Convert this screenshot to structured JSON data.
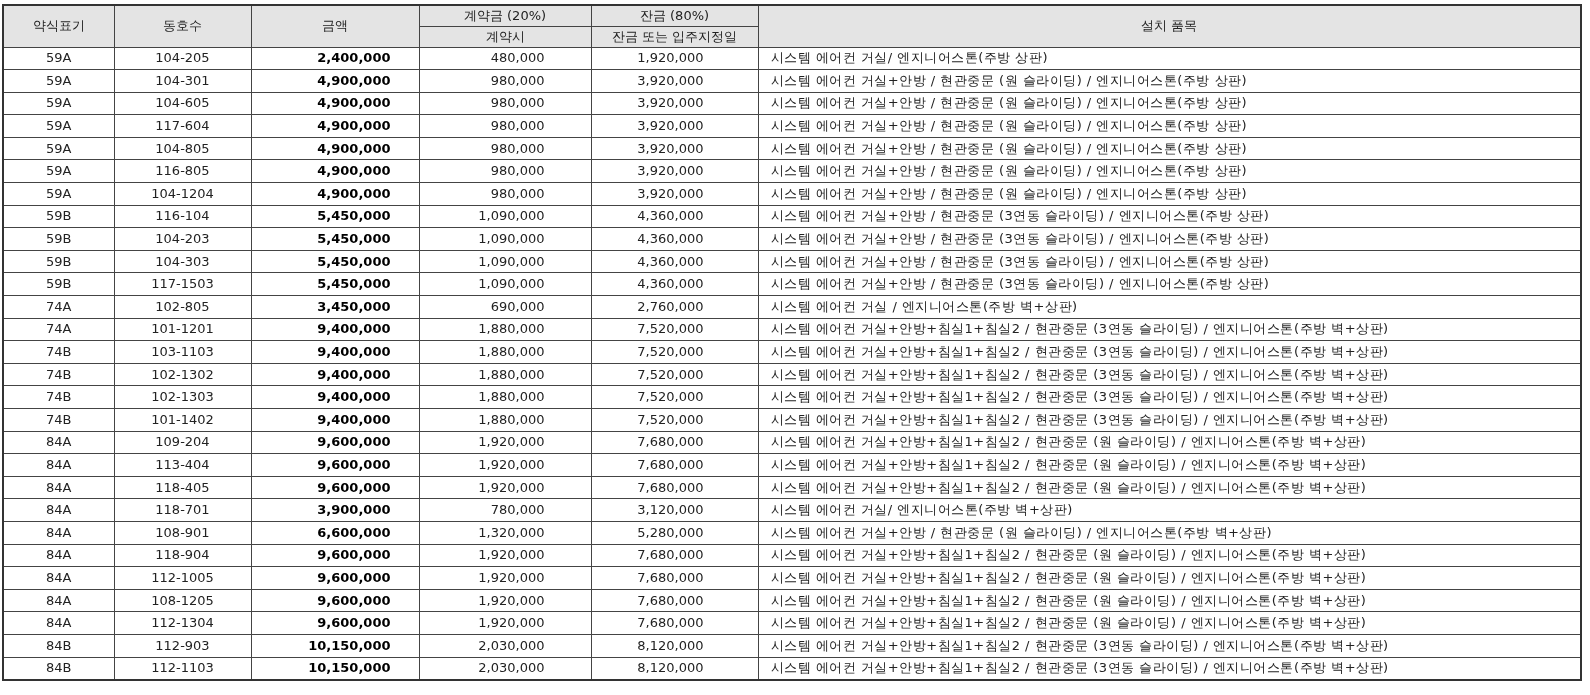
{
  "table": {
    "header": {
      "type": "약식표기",
      "unit": "동호수",
      "amount": "금액",
      "deposit_group": "계약금 (20%)",
      "deposit": "계약시",
      "balance_group": "잔금 (80%)",
      "balance": "잔금 또는 입주지정일",
      "items": "설치 품목"
    },
    "rows": [
      {
        "type": "59A",
        "unit": "104-205",
        "amount": "2,400,000",
        "deposit": "480,000",
        "balance": "1,920,000",
        "items": "시스템 에어컨 거실/ 엔지니어스톤(주방 상판)"
      },
      {
        "type": "59A",
        "unit": "104-301",
        "amount": "4,900,000",
        "deposit": "980,000",
        "balance": "3,920,000",
        "items": "시스템 에어컨 거실+안방 / 현관중문 (원 슬라이딩) / 엔지니어스톤(주방 상판)"
      },
      {
        "type": "59A",
        "unit": "104-605",
        "amount": "4,900,000",
        "deposit": "980,000",
        "balance": "3,920,000",
        "items": "시스템 에어컨 거실+안방 / 현관중문 (원 슬라이딩) / 엔지니어스톤(주방 상판)"
      },
      {
        "type": "59A",
        "unit": "117-604",
        "amount": "4,900,000",
        "deposit": "980,000",
        "balance": "3,920,000",
        "items": "시스템 에어컨 거실+안방 / 현관중문 (원 슬라이딩) / 엔지니어스톤(주방 상판)"
      },
      {
        "type": "59A",
        "unit": "104-805",
        "amount": "4,900,000",
        "deposit": "980,000",
        "balance": "3,920,000",
        "items": "시스템 에어컨 거실+안방 / 현관중문 (원 슬라이딩) / 엔지니어스톤(주방 상판)"
      },
      {
        "type": "59A",
        "unit": "116-805",
        "amount": "4,900,000",
        "deposit": "980,000",
        "balance": "3,920,000",
        "items": "시스템 에어컨 거실+안방 / 현관중문 (원 슬라이딩) / 엔지니어스톤(주방 상판)"
      },
      {
        "type": "59A",
        "unit": "104-1204",
        "amount": "4,900,000",
        "deposit": "980,000",
        "balance": "3,920,000",
        "items": "시스템 에어컨 거실+안방 / 현관중문 (원 슬라이딩) / 엔지니어스톤(주방 상판)"
      },
      {
        "type": "59B",
        "unit": "116-104",
        "amount": "5,450,000",
        "deposit": "1,090,000",
        "balance": "4,360,000",
        "items": "시스템 에어컨 거실+안방 / 현관중문 (3연동 슬라이딩) / 엔지니어스톤(주방 상판)"
      },
      {
        "type": "59B",
        "unit": "104-203",
        "amount": "5,450,000",
        "deposit": "1,090,000",
        "balance": "4,360,000",
        "items": "시스템 에어컨 거실+안방 / 현관중문 (3연동 슬라이딩) / 엔지니어스톤(주방 상판)"
      },
      {
        "type": "59B",
        "unit": "104-303",
        "amount": "5,450,000",
        "deposit": "1,090,000",
        "balance": "4,360,000",
        "items": "시스템 에어컨 거실+안방 / 현관중문 (3연동 슬라이딩) / 엔지니어스톤(주방 상판)"
      },
      {
        "type": "59B",
        "unit": "117-1503",
        "amount": "5,450,000",
        "deposit": "1,090,000",
        "balance": "4,360,000",
        "items": "시스템 에어컨 거실+안방 / 현관중문 (3연동 슬라이딩) / 엔지니어스톤(주방 상판)"
      },
      {
        "type": "74A",
        "unit": "102-805",
        "amount": "3,450,000",
        "deposit": "690,000",
        "balance": "2,760,000",
        "items": "시스템 에어컨 거실 / 엔지니어스톤(주방 벽+상판)"
      },
      {
        "type": "74A",
        "unit": "101-1201",
        "amount": "9,400,000",
        "deposit": "1,880,000",
        "balance": "7,520,000",
        "items": "시스템 에어컨 거실+안방+침실1+침실2 / 현관중문 (3연동 슬라이딩) / 엔지니어스톤(주방 벽+상판)"
      },
      {
        "type": "74B",
        "unit": "103-1103",
        "amount": "9,400,000",
        "deposit": "1,880,000",
        "balance": "7,520,000",
        "items": "시스템 에어컨 거실+안방+침실1+침실2 / 현관중문 (3연동 슬라이딩) / 엔지니어스톤(주방 벽+상판)"
      },
      {
        "type": "74B",
        "unit": "102-1302",
        "amount": "9,400,000",
        "deposit": "1,880,000",
        "balance": "7,520,000",
        "items": "시스템 에어컨 거실+안방+침실1+침실2 / 현관중문 (3연동 슬라이딩) / 엔지니어스톤(주방 벽+상판)"
      },
      {
        "type": "74B",
        "unit": "102-1303",
        "amount": "9,400,000",
        "deposit": "1,880,000",
        "balance": "7,520,000",
        "items": "시스템 에어컨 거실+안방+침실1+침실2 / 현관중문 (3연동 슬라이딩) / 엔지니어스톤(주방 벽+상판)"
      },
      {
        "type": "74B",
        "unit": "101-1402",
        "amount": "9,400,000",
        "deposit": "1,880,000",
        "balance": "7,520,000",
        "items": "시스템 에어컨 거실+안방+침실1+침실2 / 현관중문 (3연동 슬라이딩) / 엔지니어스톤(주방 벽+상판)"
      },
      {
        "type": "84A",
        "unit": "109-204",
        "amount": "9,600,000",
        "deposit": "1,920,000",
        "balance": "7,680,000",
        "items": "시스템 에어컨 거실+안방+침실1+침실2 / 현관중문 (원 슬라이딩) / 엔지니어스톤(주방 벽+상판)"
      },
      {
        "type": "84A",
        "unit": "113-404",
        "amount": "9,600,000",
        "deposit": "1,920,000",
        "balance": "7,680,000",
        "items": "시스템 에어컨 거실+안방+침실1+침실2 / 현관중문 (원 슬라이딩) / 엔지니어스톤(주방 벽+상판)"
      },
      {
        "type": "84A",
        "unit": "118-405",
        "amount": "9,600,000",
        "deposit": "1,920,000",
        "balance": "7,680,000",
        "items": "시스템 에어컨 거실+안방+침실1+침실2 / 현관중문 (원 슬라이딩) / 엔지니어스톤(주방 벽+상판)"
      },
      {
        "type": "84A",
        "unit": "118-701",
        "amount": "3,900,000",
        "deposit": "780,000",
        "balance": "3,120,000",
        "items": "시스템 에어컨 거실/ 엔지니어스톤(주방 벽+상판)"
      },
      {
        "type": "84A",
        "unit": "108-901",
        "amount": "6,600,000",
        "deposit": "1,320,000",
        "balance": "5,280,000",
        "items": "시스템 에어컨 거실+안방 / 현관중문 (원 슬라이딩) / 엔지니어스톤(주방 벽+상판)"
      },
      {
        "type": "84A",
        "unit": "118-904",
        "amount": "9,600,000",
        "deposit": "1,920,000",
        "balance": "7,680,000",
        "items": "시스템 에어컨 거실+안방+침실1+침실2 / 현관중문 (원 슬라이딩) / 엔지니어스톤(주방 벽+상판)"
      },
      {
        "type": "84A",
        "unit": "112-1005",
        "amount": "9,600,000",
        "deposit": "1,920,000",
        "balance": "7,680,000",
        "items": "시스템 에어컨 거실+안방+침실1+침실2 / 현관중문 (원 슬라이딩) / 엔지니어스톤(주방 벽+상판)"
      },
      {
        "type": "84A",
        "unit": "108-1205",
        "amount": "9,600,000",
        "deposit": "1,920,000",
        "balance": "7,680,000",
        "items": "시스템 에어컨 거실+안방+침실1+침실2 / 현관중문 (원 슬라이딩) / 엔지니어스톤(주방 벽+상판)"
      },
      {
        "type": "84A",
        "unit": "112-1304",
        "amount": "9,600,000",
        "deposit": "1,920,000",
        "balance": "7,680,000",
        "items": "시스템 에어컨 거실+안방+침실1+침실2 / 현관중문 (원 슬라이딩) / 엔지니어스톤(주방 벽+상판)"
      },
      {
        "type": "84B",
        "unit": "112-903",
        "amount": "10,150,000",
        "deposit": "2,030,000",
        "balance": "8,120,000",
        "items": "시스템 에어컨 거실+안방+침실1+침실2 / 현관중문 (3연동 슬라이딩) / 엔지니어스톤(주방 벽+상판)"
      },
      {
        "type": "84B",
        "unit": "112-1103",
        "amount": "10,150,000",
        "deposit": "2,030,000",
        "balance": "8,120,000",
        "items": "시스템 에어컨 거실+안방+침실1+침실2 / 현관중문 (3연동 슬라이딩) / 엔지니어스톤(주방 벽+상판)"
      }
    ]
  }
}
